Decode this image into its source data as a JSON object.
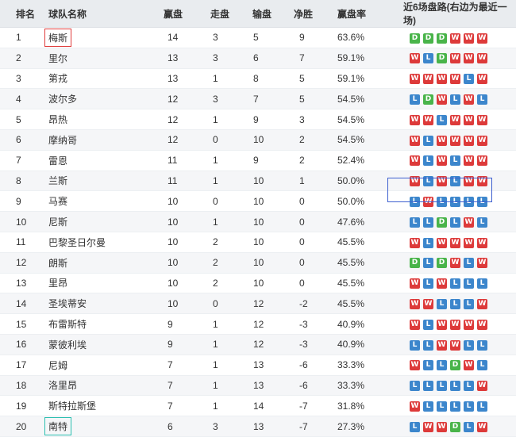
{
  "headers": [
    "排名",
    "球队名称",
    "赢盘",
    "走盘",
    "输盘",
    "净胜",
    "赢盘率",
    "近6场盘路(右边为最近一场)"
  ],
  "rows": [
    {
      "rank": "1",
      "team": "梅斯",
      "win": "14",
      "draw": "3",
      "loss": "5",
      "net": "9",
      "rate": "63.6%",
      "form": [
        "D",
        "D",
        "D",
        "W",
        "W",
        "W"
      ]
    },
    {
      "rank": "2",
      "team": "里尔",
      "win": "13",
      "draw": "3",
      "loss": "6",
      "net": "7",
      "rate": "59.1%",
      "form": [
        "W",
        "L",
        "D",
        "W",
        "W",
        "W"
      ]
    },
    {
      "rank": "3",
      "team": "第戎",
      "win": "13",
      "draw": "1",
      "loss": "8",
      "net": "5",
      "rate": "59.1%",
      "form": [
        "W",
        "W",
        "W",
        "W",
        "L",
        "W"
      ]
    },
    {
      "rank": "4",
      "team": "波尔多",
      "win": "12",
      "draw": "3",
      "loss": "7",
      "net": "5",
      "rate": "54.5%",
      "form": [
        "L",
        "D",
        "W",
        "L",
        "W",
        "L"
      ]
    },
    {
      "rank": "5",
      "team": "昂热",
      "win": "12",
      "draw": "1",
      "loss": "9",
      "net": "3",
      "rate": "54.5%",
      "form": [
        "W",
        "W",
        "L",
        "W",
        "W",
        "W"
      ]
    },
    {
      "rank": "6",
      "team": "摩纳哥",
      "win": "12",
      "draw": "0",
      "loss": "10",
      "net": "2",
      "rate": "54.5%",
      "form": [
        "W",
        "L",
        "W",
        "W",
        "W",
        "W"
      ]
    },
    {
      "rank": "7",
      "team": "雷恩",
      "win": "11",
      "draw": "1",
      "loss": "9",
      "net": "2",
      "rate": "52.4%",
      "form": [
        "W",
        "L",
        "W",
        "L",
        "W",
        "W"
      ]
    },
    {
      "rank": "8",
      "team": "兰斯",
      "win": "11",
      "draw": "1",
      "loss": "10",
      "net": "1",
      "rate": "50.0%",
      "form": [
        "W",
        "L",
        "W",
        "L",
        "W",
        "W"
      ]
    },
    {
      "rank": "9",
      "team": "马赛",
      "win": "10",
      "draw": "0",
      "loss": "10",
      "net": "0",
      "rate": "50.0%",
      "form": [
        "L",
        "W",
        "L",
        "L",
        "L",
        "L"
      ]
    },
    {
      "rank": "10",
      "team": "尼斯",
      "win": "10",
      "draw": "1",
      "loss": "10",
      "net": "0",
      "rate": "47.6%",
      "form": [
        "L",
        "L",
        "D",
        "L",
        "W",
        "L"
      ]
    },
    {
      "rank": "11",
      "team": "巴黎圣日尔曼",
      "win": "10",
      "draw": "2",
      "loss": "10",
      "net": "0",
      "rate": "45.5%",
      "form": [
        "W",
        "L",
        "W",
        "W",
        "W",
        "W"
      ]
    },
    {
      "rank": "12",
      "team": "朗斯",
      "win": "10",
      "draw": "2",
      "loss": "10",
      "net": "0",
      "rate": "45.5%",
      "form": [
        "D",
        "L",
        "D",
        "W",
        "L",
        "W"
      ]
    },
    {
      "rank": "13",
      "team": "里昂",
      "win": "10",
      "draw": "2",
      "loss": "10",
      "net": "0",
      "rate": "45.5%",
      "form": [
        "W",
        "L",
        "W",
        "L",
        "L",
        "L"
      ]
    },
    {
      "rank": "14",
      "team": "圣埃蒂安",
      "win": "10",
      "draw": "0",
      "loss": "12",
      "net": "-2",
      "rate": "45.5%",
      "form": [
        "W",
        "W",
        "L",
        "L",
        "L",
        "W"
      ]
    },
    {
      "rank": "15",
      "team": "布雷斯特",
      "win": "9",
      "draw": "1",
      "loss": "12",
      "net": "-3",
      "rate": "40.9%",
      "form": [
        "W",
        "L",
        "W",
        "W",
        "W",
        "W"
      ]
    },
    {
      "rank": "16",
      "team": "蒙彼利埃",
      "win": "9",
      "draw": "1",
      "loss": "12",
      "net": "-3",
      "rate": "40.9%",
      "form": [
        "L",
        "L",
        "W",
        "W",
        "L",
        "L"
      ]
    },
    {
      "rank": "17",
      "team": "尼姆",
      "win": "7",
      "draw": "1",
      "loss": "13",
      "net": "-6",
      "rate": "33.3%",
      "form": [
        "W",
        "L",
        "L",
        "D",
        "W",
        "L"
      ]
    },
    {
      "rank": "18",
      "team": "洛里昂",
      "win": "7",
      "draw": "1",
      "loss": "13",
      "net": "-6",
      "rate": "33.3%",
      "form": [
        "L",
        "L",
        "L",
        "L",
        "L",
        "W"
      ]
    },
    {
      "rank": "19",
      "team": "斯特拉斯堡",
      "win": "7",
      "draw": "1",
      "loss": "14",
      "net": "-7",
      "rate": "31.8%",
      "form": [
        "W",
        "L",
        "L",
        "L",
        "L",
        "L"
      ]
    },
    {
      "rank": "20",
      "team": "南特",
      "win": "6",
      "draw": "3",
      "loss": "13",
      "net": "-7",
      "rate": "27.3%",
      "form": [
        "L",
        "W",
        "W",
        "D",
        "L",
        "W"
      ]
    }
  ],
  "highlights": {
    "red_team_rank": "1",
    "teal_team_rank": "20",
    "form_box_rank": "9"
  },
  "colors": {
    "W": "#dd3a3a",
    "L": "#3c86cc",
    "D": "#49b44a",
    "header_bg": "#e9ecef"
  }
}
